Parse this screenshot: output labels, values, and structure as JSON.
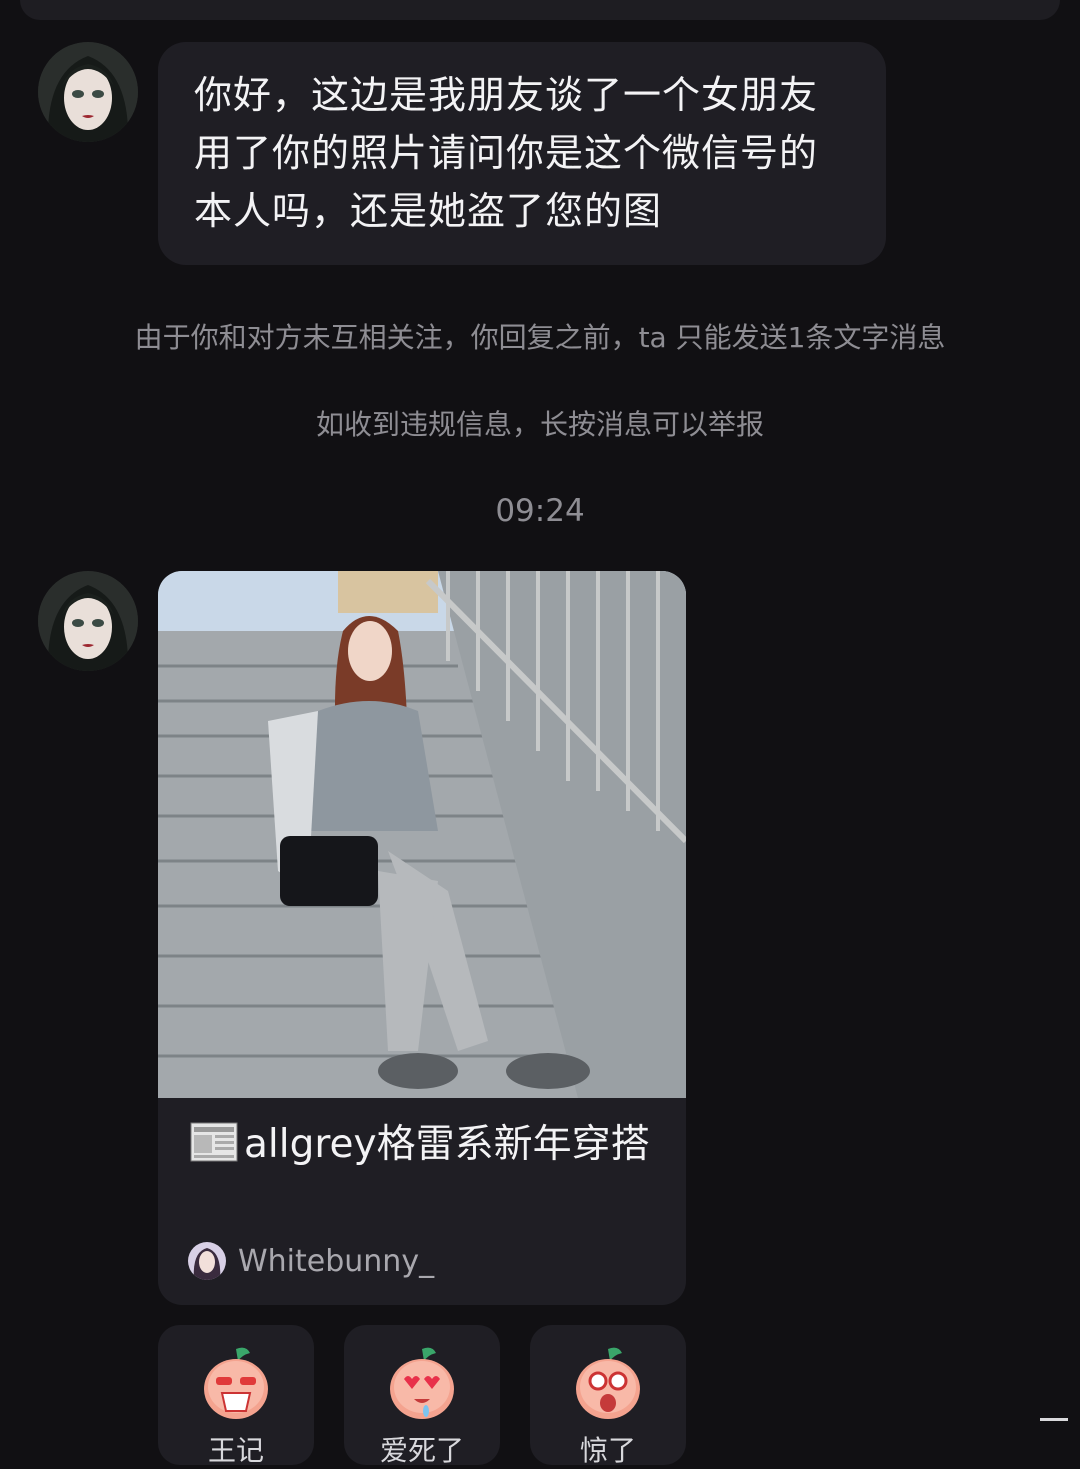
{
  "messages": [
    {
      "text_lines": [
        "你好，这边是我朋友谈了一个女朋友",
        "用了你的照片请问你是这个微信号的",
        "本人吗，还是她盗了您的图"
      ]
    }
  ],
  "notices": {
    "follow_notice": "由于你和对方未互相关注，你回复之前，ta 只能发送1条文字消息",
    "report_notice": "如收到违规信息，长按消息可以举报"
  },
  "timestamp": "09:24",
  "shared_post": {
    "title": "allgrey格雷系新年穿搭",
    "author": "Whitebunny_",
    "title_icon": "newspaper-icon"
  },
  "reactions": [
    {
      "icon": "sticker-cup-icon",
      "label": "王记"
    },
    {
      "icon": "sticker-heart-eyes-icon",
      "label": "爱死了"
    },
    {
      "icon": "sticker-star-eyes-icon",
      "label": "惊了"
    }
  ],
  "colors": {
    "background": "#111013",
    "bubble": "#1f1e24",
    "secondary_text": "#8e8d93"
  }
}
